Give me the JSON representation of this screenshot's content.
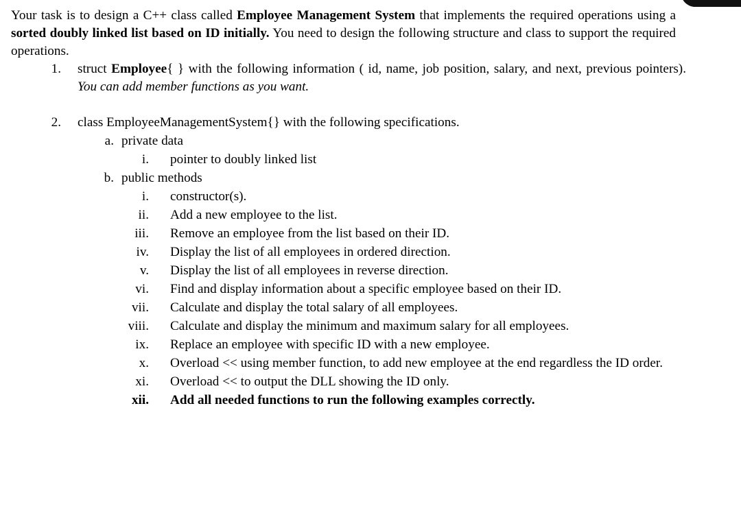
{
  "document": {
    "intro": {
      "seg1": "Your task is to design a C++ class called ",
      "bold1": "Employee Management System",
      "seg2": " that implements the required operations using a ",
      "bold2": "sorted doubly linked list based on ID initially.",
      "seg3": " You need to design the following",
      "seg4": "structure and class to support the required operations."
    },
    "items": [
      {
        "marker": "1.",
        "seg1": "struct ",
        "bold1": "Employee",
        "seg2": "{ }  with the following information ( id, name, job position, salary, and next,",
        "seg3": "previous pointers). ",
        "italic1": "You can add member functions as you want."
      },
      {
        "marker": "2.",
        "text": "class EmployeeManagementSystem{}   with the following specifications."
      }
    ],
    "sub_a": {
      "marker": "a.",
      "label": "private data"
    },
    "sub_a_items": [
      {
        "marker": "i.",
        "text": "pointer to doubly linked list"
      }
    ],
    "sub_b": {
      "marker": "b.",
      "label": "public methods"
    },
    "methods": [
      {
        "marker": "i.",
        "text": "constructor(s)."
      },
      {
        "marker": "ii.",
        "text": "Add a new employee to the list."
      },
      {
        "marker": "iii.",
        "text": "Remove an employee from the list based on their ID."
      },
      {
        "marker": "iv.",
        "text": "Display the list of all employees in ordered direction."
      },
      {
        "marker": "v.",
        "text": "Display the list of all employees in reverse direction."
      },
      {
        "marker": "vi.",
        "text": "Find and display information about a specific employee based on their ID."
      },
      {
        "marker": "vii.",
        "text": "Calculate and display the total salary of all employees."
      },
      {
        "marker": "viii.",
        "text": "Calculate and display the minimum and maximum salary for all employees."
      },
      {
        "marker": "ix.",
        "text": "Replace an employee with specific ID with a new employee."
      },
      {
        "marker": "x.",
        "text": "Overload << using member function, to add new employee at the end",
        "text2": "regardless the ID order."
      },
      {
        "marker": "xi.",
        "text": "Overload << to output the DLL showing the ID only."
      },
      {
        "marker": "xii.",
        "text": "Add all needed functions to run the following examples correctly."
      }
    ]
  },
  "colors": {
    "background": "#ffffff",
    "text": "#000000",
    "artifact": "#111111"
  }
}
